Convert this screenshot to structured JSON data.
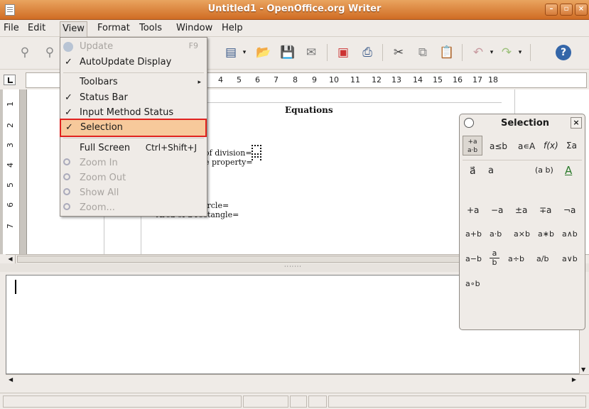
{
  "window": {
    "title": "Untitled1 - OpenOffice.org Writer",
    "buttons": [
      "–",
      "▫",
      "×"
    ]
  },
  "menubar": {
    "items": [
      "File",
      "Edit",
      "View",
      "Format",
      "Tools",
      "Window",
      "Help"
    ],
    "active_index": 2
  },
  "view_menu": {
    "items": [
      {
        "label": "Update",
        "accel": "F9",
        "disabled": true,
        "check": ""
      },
      {
        "label": "AutoUpdate Display",
        "accel": "",
        "disabled": false,
        "check": "✓"
      },
      {
        "label": "Toolbars",
        "accel": "▸",
        "disabled": false,
        "check": ""
      },
      {
        "label": "Status Bar",
        "accel": "",
        "disabled": false,
        "check": "✓"
      },
      {
        "label": "Input Method Status",
        "accel": "",
        "disabled": false,
        "check": "✓"
      },
      {
        "label": "Selection",
        "accel": "",
        "disabled": false,
        "check": "✓",
        "highlighted": true
      },
      {
        "label": "Full Screen",
        "accel": "Ctrl+Shift+J",
        "disabled": false,
        "check": ""
      },
      {
        "label": "Zoom In",
        "accel": "",
        "disabled": true,
        "check": ""
      },
      {
        "label": "Zoom Out",
        "accel": "",
        "disabled": true,
        "check": ""
      },
      {
        "label": "Show All",
        "accel": "",
        "disabled": true,
        "check": ""
      },
      {
        "label": "Zoom...",
        "accel": "",
        "disabled": true,
        "check": ""
      }
    ]
  },
  "ruler": {
    "numbers": [
      "4",
      "5",
      "6",
      "7",
      "8",
      "9",
      "10",
      "11",
      "12",
      "13",
      "14",
      "15",
      "16",
      "17",
      "18"
    ],
    "vertical_numbers": [
      "1",
      "2",
      "3",
      "4",
      "5",
      "6",
      "7"
    ]
  },
  "document": {
    "title": "Equations",
    "lines": [
      "of division=",
      "e property=",
      "ircle=",
      "Area of a rectangle="
    ]
  },
  "selection_panel": {
    "title": "Selection",
    "close": "×",
    "rows": [
      [
        "a≤b",
        "a∊A",
        "f(x)",
        "Σa"
      ],
      [
        "a⃗",
        "a",
        "(a b)",
        "A"
      ],
      [
        "+a",
        "−a",
        "±a",
        "∓a",
        "¬a"
      ],
      [
        "a+b",
        "a·b",
        "a×b",
        "a∗b",
        "a∧b"
      ],
      [
        "a−b",
        "a/b frac",
        "a÷b",
        "a/b",
        "a∨b"
      ],
      [
        "a∘b"
      ]
    ],
    "first_row_active": "+a a-b"
  },
  "colors": {
    "titlebar": "#d06c24",
    "menu_highlight": "#f7c99b",
    "annotation_box": "#e0221f"
  }
}
